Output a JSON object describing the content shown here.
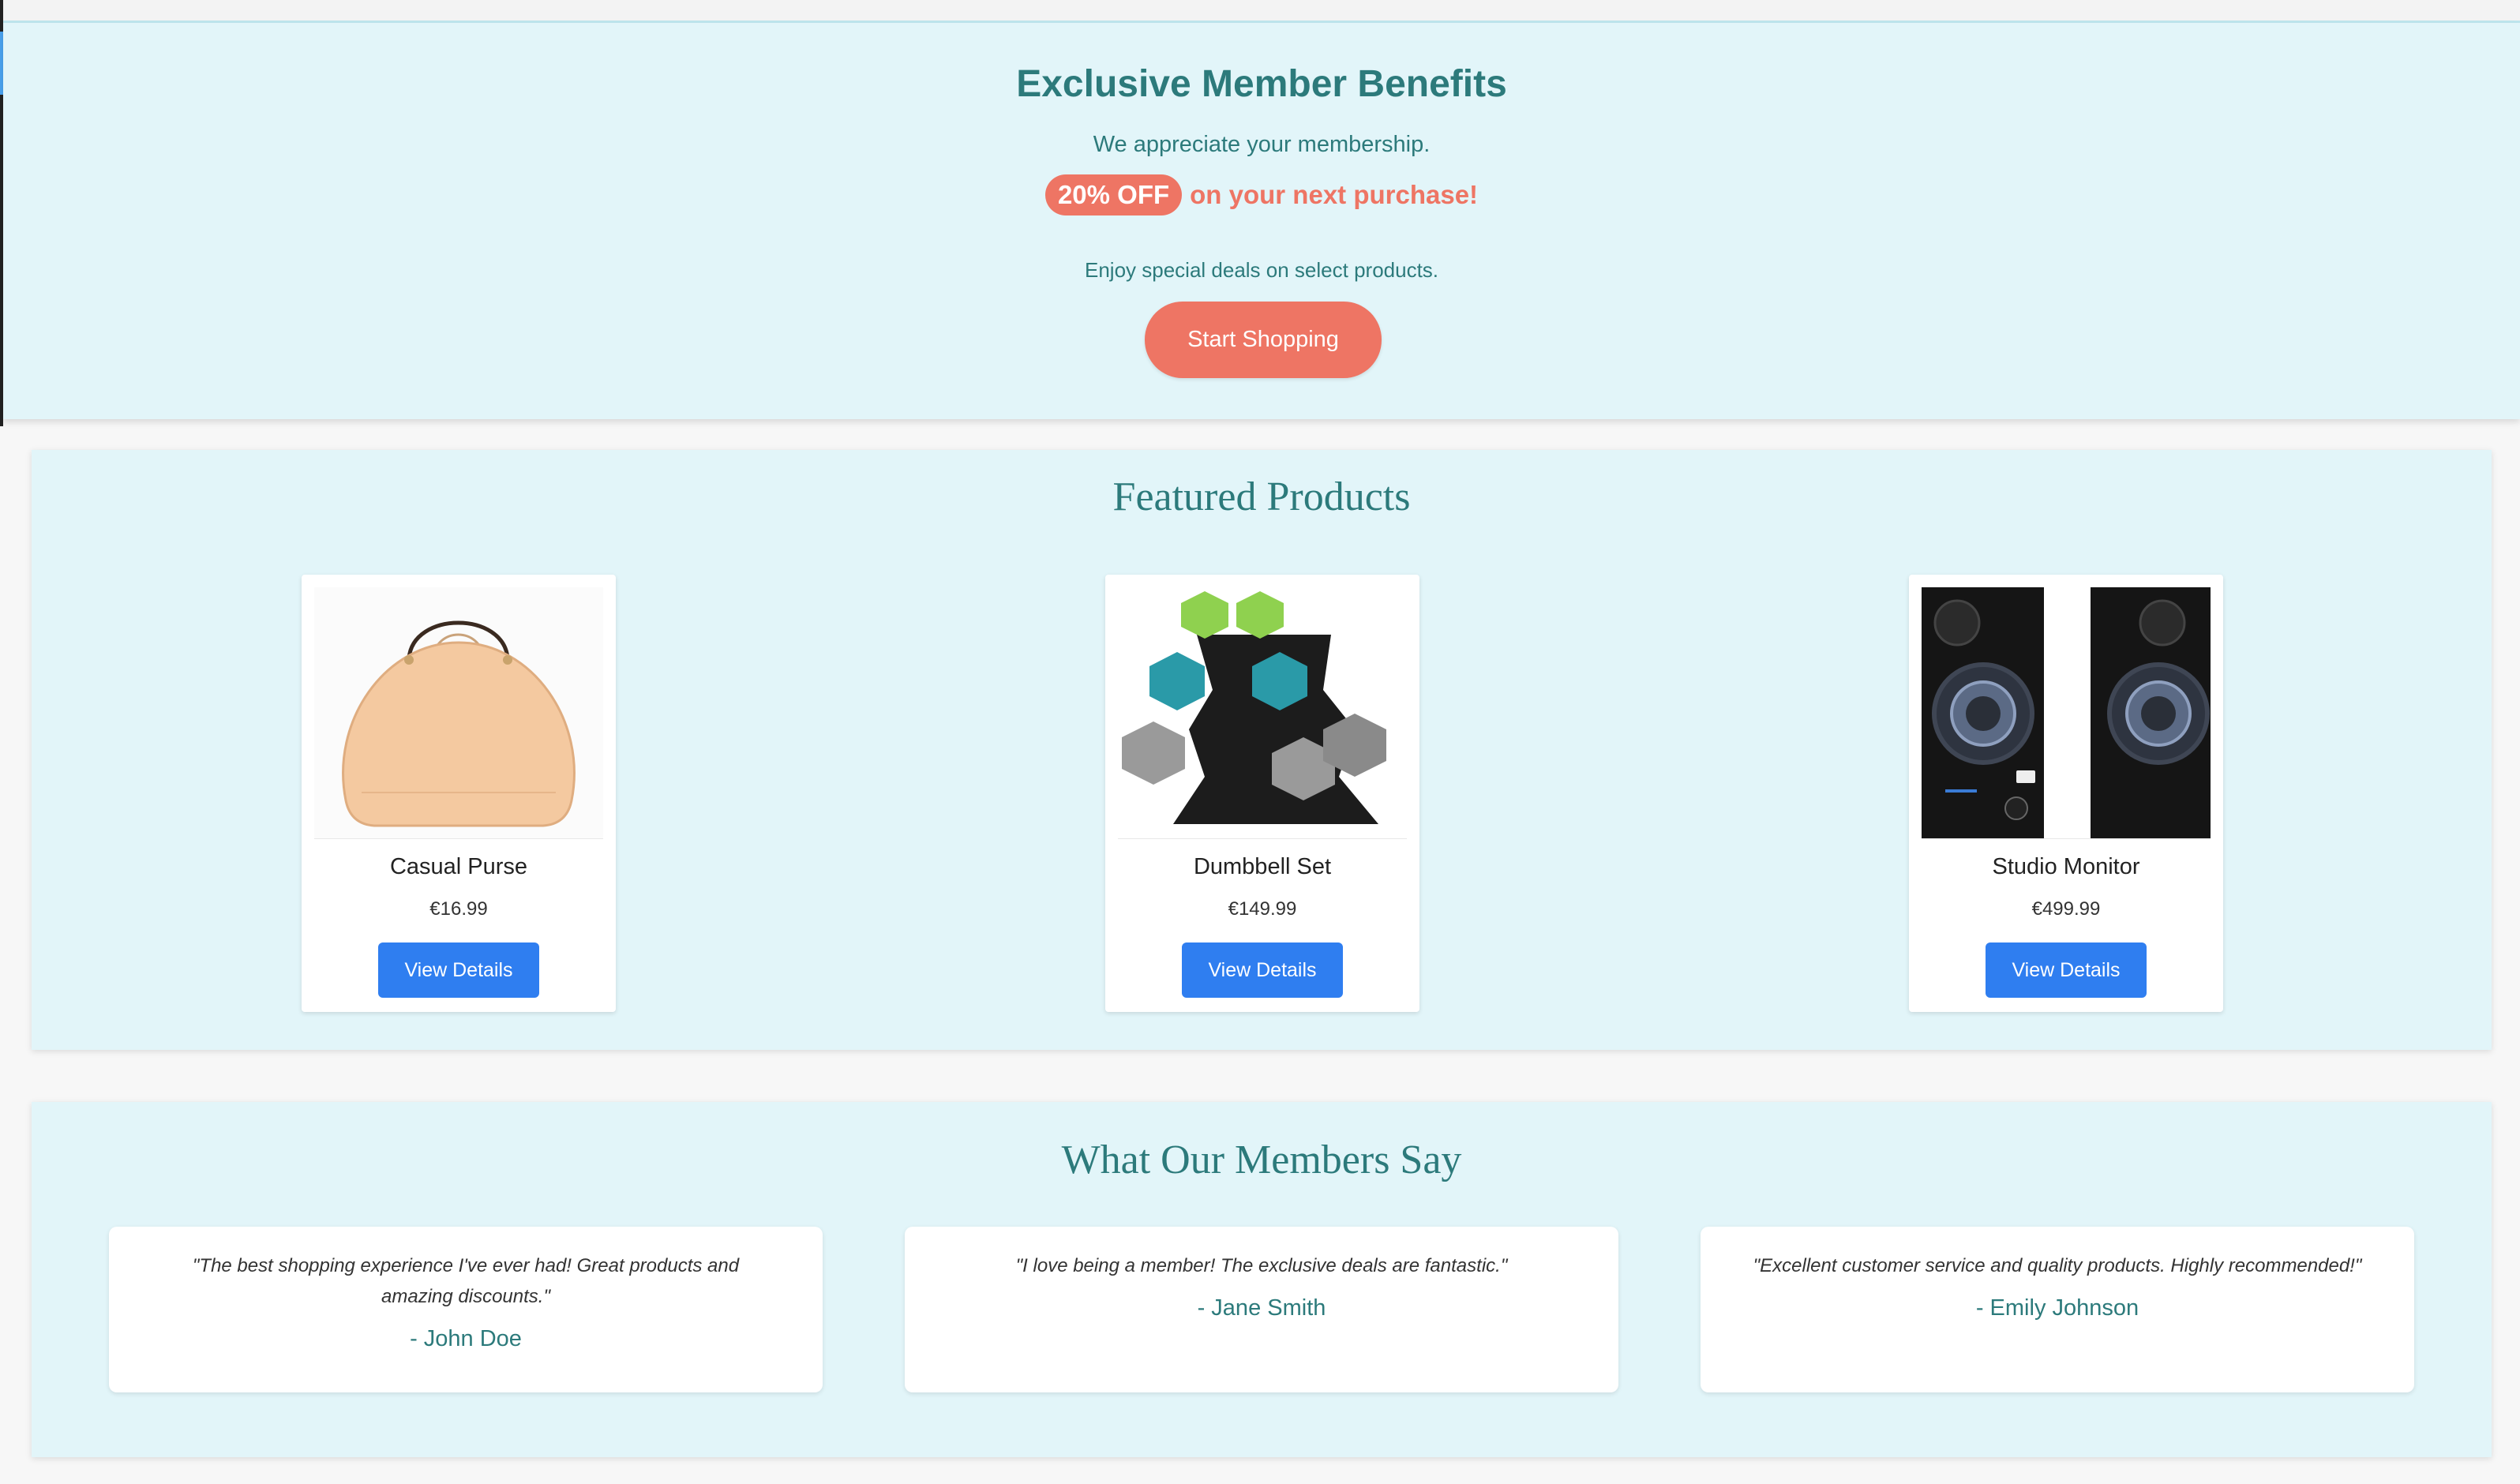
{
  "hero": {
    "title": "Exclusive Member Benefits",
    "subtitle": "We appreciate your membership.",
    "offer_badge": "20% OFF",
    "offer_text": "on your next purchase!",
    "note": "Enjoy special deals on select products.",
    "cta_label": "Start Shopping"
  },
  "featured": {
    "title": "Featured Products",
    "products": [
      {
        "name": "Casual Purse",
        "price": "€16.99",
        "button": "View Details",
        "image": "purse-image"
      },
      {
        "name": "Dumbbell Set",
        "price": "€149.99",
        "button": "View Details",
        "image": "dumbbell-image"
      },
      {
        "name": "Studio Monitor",
        "price": "€499.99",
        "button": "View Details",
        "image": "speaker-image"
      }
    ]
  },
  "testimonials": {
    "title": "What Our Members Say",
    "items": [
      {
        "quote": "\"The best shopping experience I've ever had! Great products and amazing discounts.\"",
        "author": "- John Doe"
      },
      {
        "quote": "\"I love being a member! The exclusive deals are fantastic.\"",
        "author": "- Jane Smith"
      },
      {
        "quote": "\"Excellent customer service and quality products. Highly recommended!\"",
        "author": "- Emily Johnson"
      }
    ]
  },
  "colors": {
    "accent_teal": "#2c7a7b",
    "coral": "#ee7564",
    "button_blue": "#2f7ef0",
    "section_bg": "#e2f5f9"
  }
}
